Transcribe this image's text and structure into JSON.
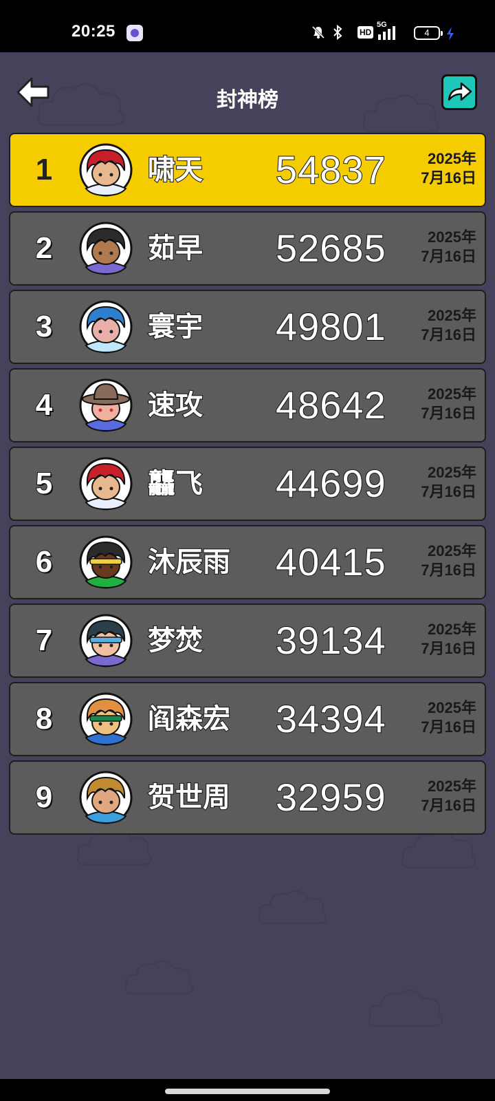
{
  "status_bar": {
    "time": "20:25",
    "network": "5G",
    "hd": "HD",
    "battery": "4"
  },
  "header": {
    "title": "封神榜"
  },
  "colors": {
    "background": "#47425c",
    "first_place_row": "#f5cc00",
    "row": "#5c5c5c",
    "share_button": "#1ec8b8"
  },
  "leaderboard": [
    {
      "rank": "1",
      "name": "啸天",
      "score": "54837",
      "date_year": "2025年",
      "date_day": "7月16日",
      "avatar": "red-hair-avatar-icon"
    },
    {
      "rank": "2",
      "name": "茹早",
      "score": "52685",
      "date_year": "2025年",
      "date_day": "7月16日",
      "avatar": "black-hair-avatar-icon"
    },
    {
      "rank": "3",
      "name": "寰宇",
      "score": "49801",
      "date_year": "2025年",
      "date_day": "7月16日",
      "avatar": "blue-hair-avatar-icon"
    },
    {
      "rank": "4",
      "name": "速攻",
      "score": "48642",
      "date_year": "2025年",
      "date_day": "7月16日",
      "avatar": "hat-avatar-icon"
    },
    {
      "rank": "5",
      "name": "龘飞",
      "score": "44699",
      "date_year": "2025年",
      "date_day": "7月16日",
      "avatar": "red-hair-avatar-icon"
    },
    {
      "rank": "6",
      "name": "沐辰雨",
      "score": "40415",
      "date_year": "2025年",
      "date_day": "7月16日",
      "avatar": "headband-avatar-icon"
    },
    {
      "rank": "7",
      "name": "梦焚",
      "score": "39134",
      "date_year": "2025年",
      "date_day": "7月16日",
      "avatar": "blindfold-avatar-icon"
    },
    {
      "rank": "8",
      "name": "阎森宏",
      "score": "34394",
      "date_year": "2025年",
      "date_day": "7月16日",
      "avatar": "goggles-avatar-icon"
    },
    {
      "rank": "9",
      "name": "贺世周",
      "score": "32959",
      "date_year": "2025年",
      "date_day": "7月16日",
      "avatar": "brown-hair-avatar-icon"
    }
  ]
}
